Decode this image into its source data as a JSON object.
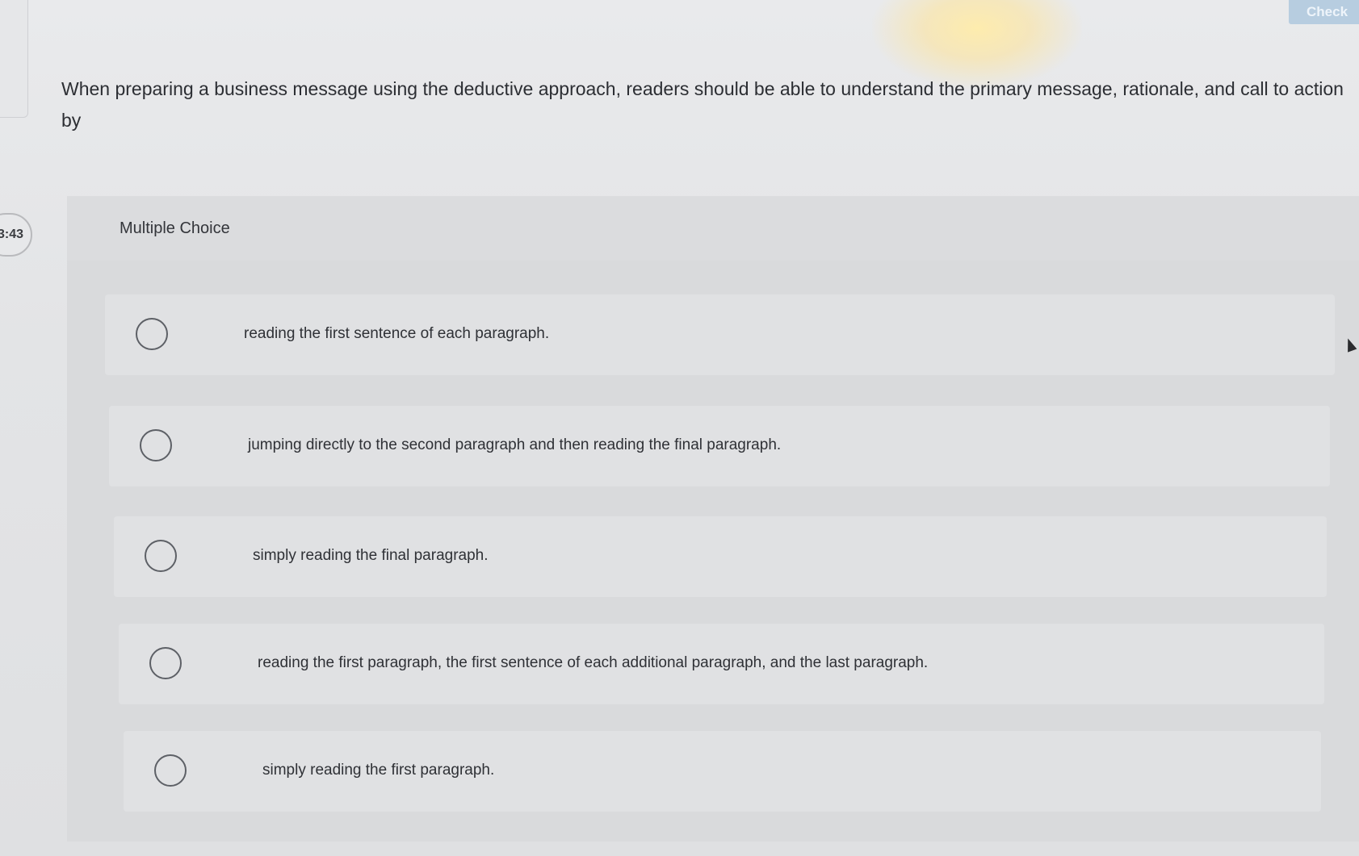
{
  "header": {
    "check_label": "Check"
  },
  "timer": {
    "value": "3:43"
  },
  "question": {
    "text": "When preparing a business message using the deductive approach, readers should be able to understand the primary message, rationale, and call to action by"
  },
  "quiz": {
    "type_label": "Multiple Choice",
    "options": [
      {
        "label": "reading the first sentence of each paragraph.",
        "selected": false
      },
      {
        "label": "jumping directly to the second paragraph and then reading the final paragraph.",
        "selected": false
      },
      {
        "label": "simply reading the final paragraph.",
        "selected": false
      },
      {
        "label": "reading the first paragraph, the first sentence of each additional paragraph, and the last paragraph.",
        "selected": false
      },
      {
        "label": "simply reading the first paragraph.",
        "selected": false
      }
    ]
  }
}
